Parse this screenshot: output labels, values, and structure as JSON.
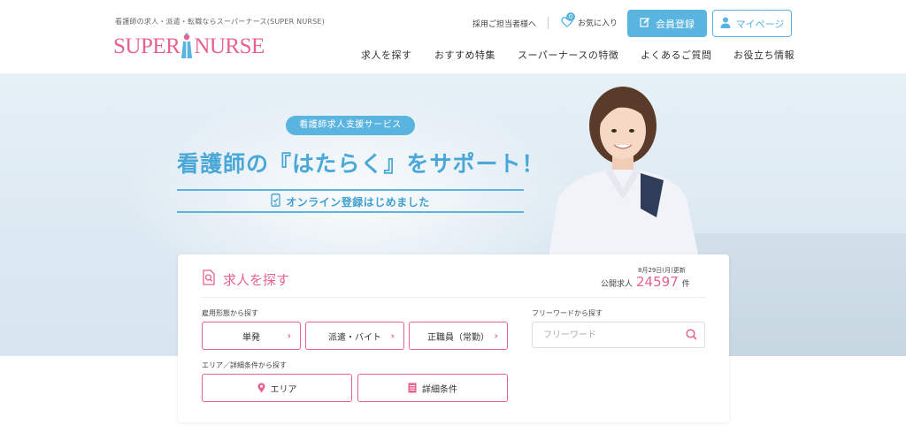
{
  "header": {
    "tagline": "看護師の求人・派遣・転職ならスーパーナース(SUPER NURSE)",
    "logo_left": "SUPER",
    "logo_right": "NURSE",
    "employer_link": "採用ご担当者様へ",
    "favorites_label": "お気に入り",
    "favorites_count": "0",
    "register_label": "会員登録",
    "mypage_label": "マイページ",
    "nav": [
      "求人を探す",
      "おすすめ特集",
      "スーパーナースの特徴",
      "よくあるご質問",
      "お役立ち情報"
    ]
  },
  "hero": {
    "pill": "看護師求人支援サービス",
    "title": "看護師の『はたらく』をサポート！",
    "online": "オンライン登録はじめました"
  },
  "search": {
    "title": "求人を探す",
    "updated": "8月29日(月)更新",
    "count_label": "公開求人",
    "count": "24597",
    "count_unit": "件",
    "employment_label": "雇用形態から探す",
    "employment": [
      "単発",
      "派遣・バイト",
      "正職員（常勤）"
    ],
    "area_label": "エリア／詳細条件から探す",
    "area_button": "エリア",
    "detail_button": "詳細条件",
    "freeword_label": "フリーワードから探す",
    "freeword_placeholder": "フリーワード"
  },
  "colors": {
    "pink": "#e8638c",
    "blue": "#5ab4e0"
  }
}
